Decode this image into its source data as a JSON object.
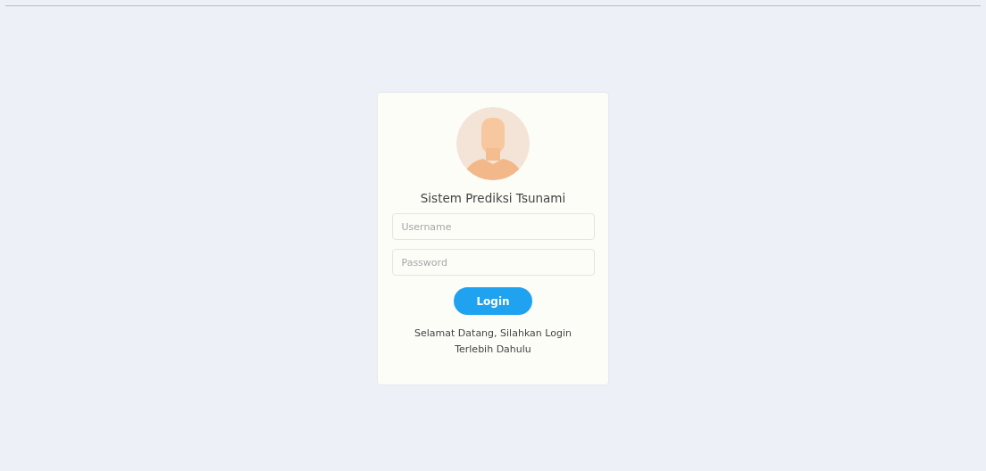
{
  "login_card": {
    "title": "Sistem Prediksi Tsunami",
    "username": {
      "placeholder": "Username"
    },
    "password": {
      "placeholder": "Password"
    },
    "login_button": "Login",
    "message": "Selamat Datang, Silahkan Login Terlebih Dahulu"
  }
}
